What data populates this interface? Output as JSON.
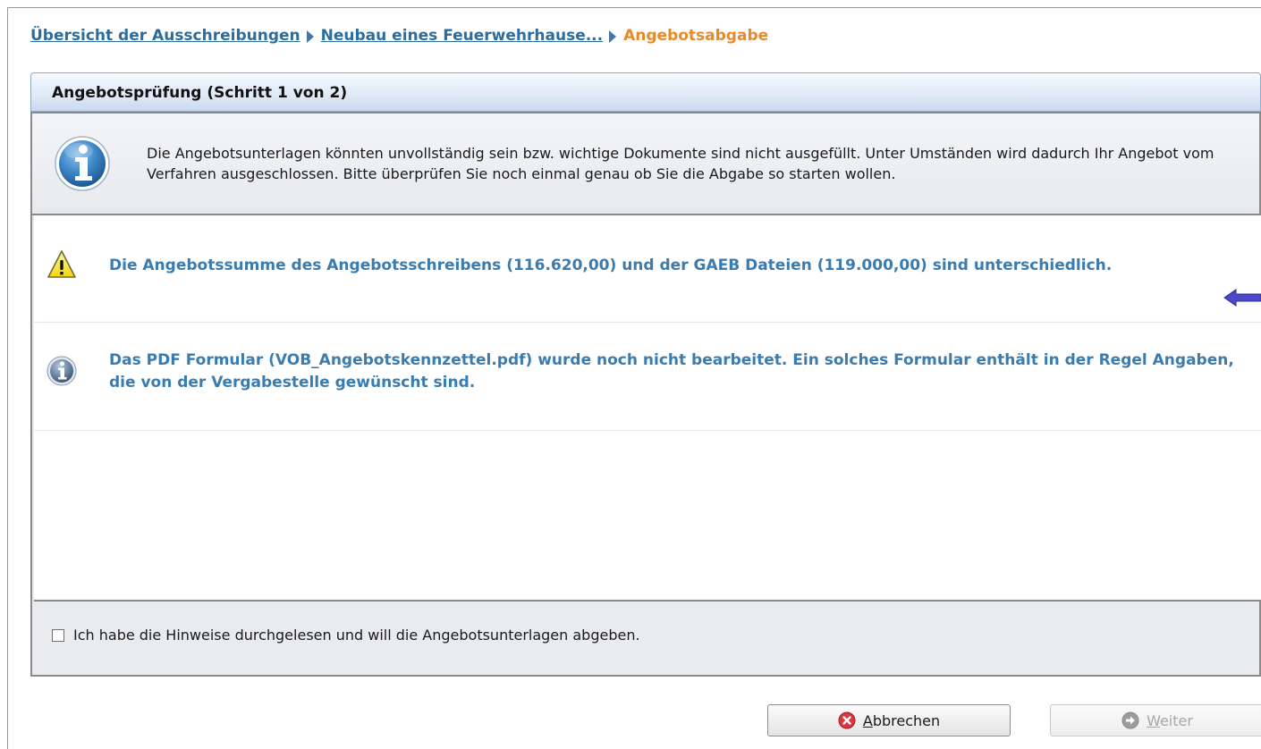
{
  "breadcrumb": {
    "items": [
      "Übersicht der Ausschreibungen",
      "Neubau eines Feuerwehrhause..."
    ],
    "current": "Angebotsabgabe"
  },
  "panel": {
    "title": "Angebotsprüfung (Schritt 1 von 2)",
    "info_message": "Die Angebotsunterlagen könnten unvollständig sein bzw. wichtige Dokumente sind nicht ausgefüllt. Unter Umständen wird dadurch Ihr Angebot vom Verfahren ausgeschlossen. Bitte überprüfen Sie noch einmal genau ob Sie die Abgabe so starten wollen.",
    "messages": [
      {
        "icon": "warning-icon",
        "text": "Die Angebotssumme des Angebotsschreibens (116.620,00) und der GAEB Dateien (119.000,00) sind unterschiedlich."
      },
      {
        "icon": "info-icon",
        "text": "Das PDF Formular (VOB_Angebotskennzettel.pdf) wurde noch nicht bearbeitet. Ein solches Formular enthält in der Regel Angaben, die von der Vergabestelle gewünscht sind."
      }
    ],
    "confirm_label": "Ich habe die Hinweise durchgelesen und will die Angebotsunterlagen abgeben.",
    "confirm_checked": false
  },
  "buttons": {
    "cancel": "Abbrechen",
    "next": "Weiter",
    "next_enabled": false
  },
  "colors": {
    "link": "#2a6d9e",
    "current_crumb": "#e98a2a",
    "message_text": "#3a7bb0",
    "cancel_icon": "#d9363e"
  }
}
